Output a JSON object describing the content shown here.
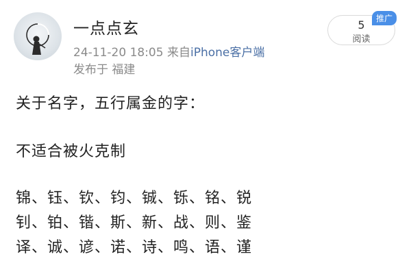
{
  "post": {
    "username": "一点点玄",
    "timestamp": "24-11-20 18:05",
    "source_prefix": "来自",
    "client": "iPhone客户端",
    "location": "发布于 福建",
    "read_count": "5",
    "read_label": "阅读",
    "badge": "推广",
    "lines": [
      "关于名字，五行属金的字：",
      "不适合被火克制",
      "锦、钰、钦、钧、铖、铄、铭、锐",
      "钊、铂、锴、斯、新、战、则、鉴",
      "译、诚、谚、诺、诗、鸣、语、谨"
    ]
  },
  "icons": {
    "avatar": "ink-figure-moon-avatar"
  }
}
